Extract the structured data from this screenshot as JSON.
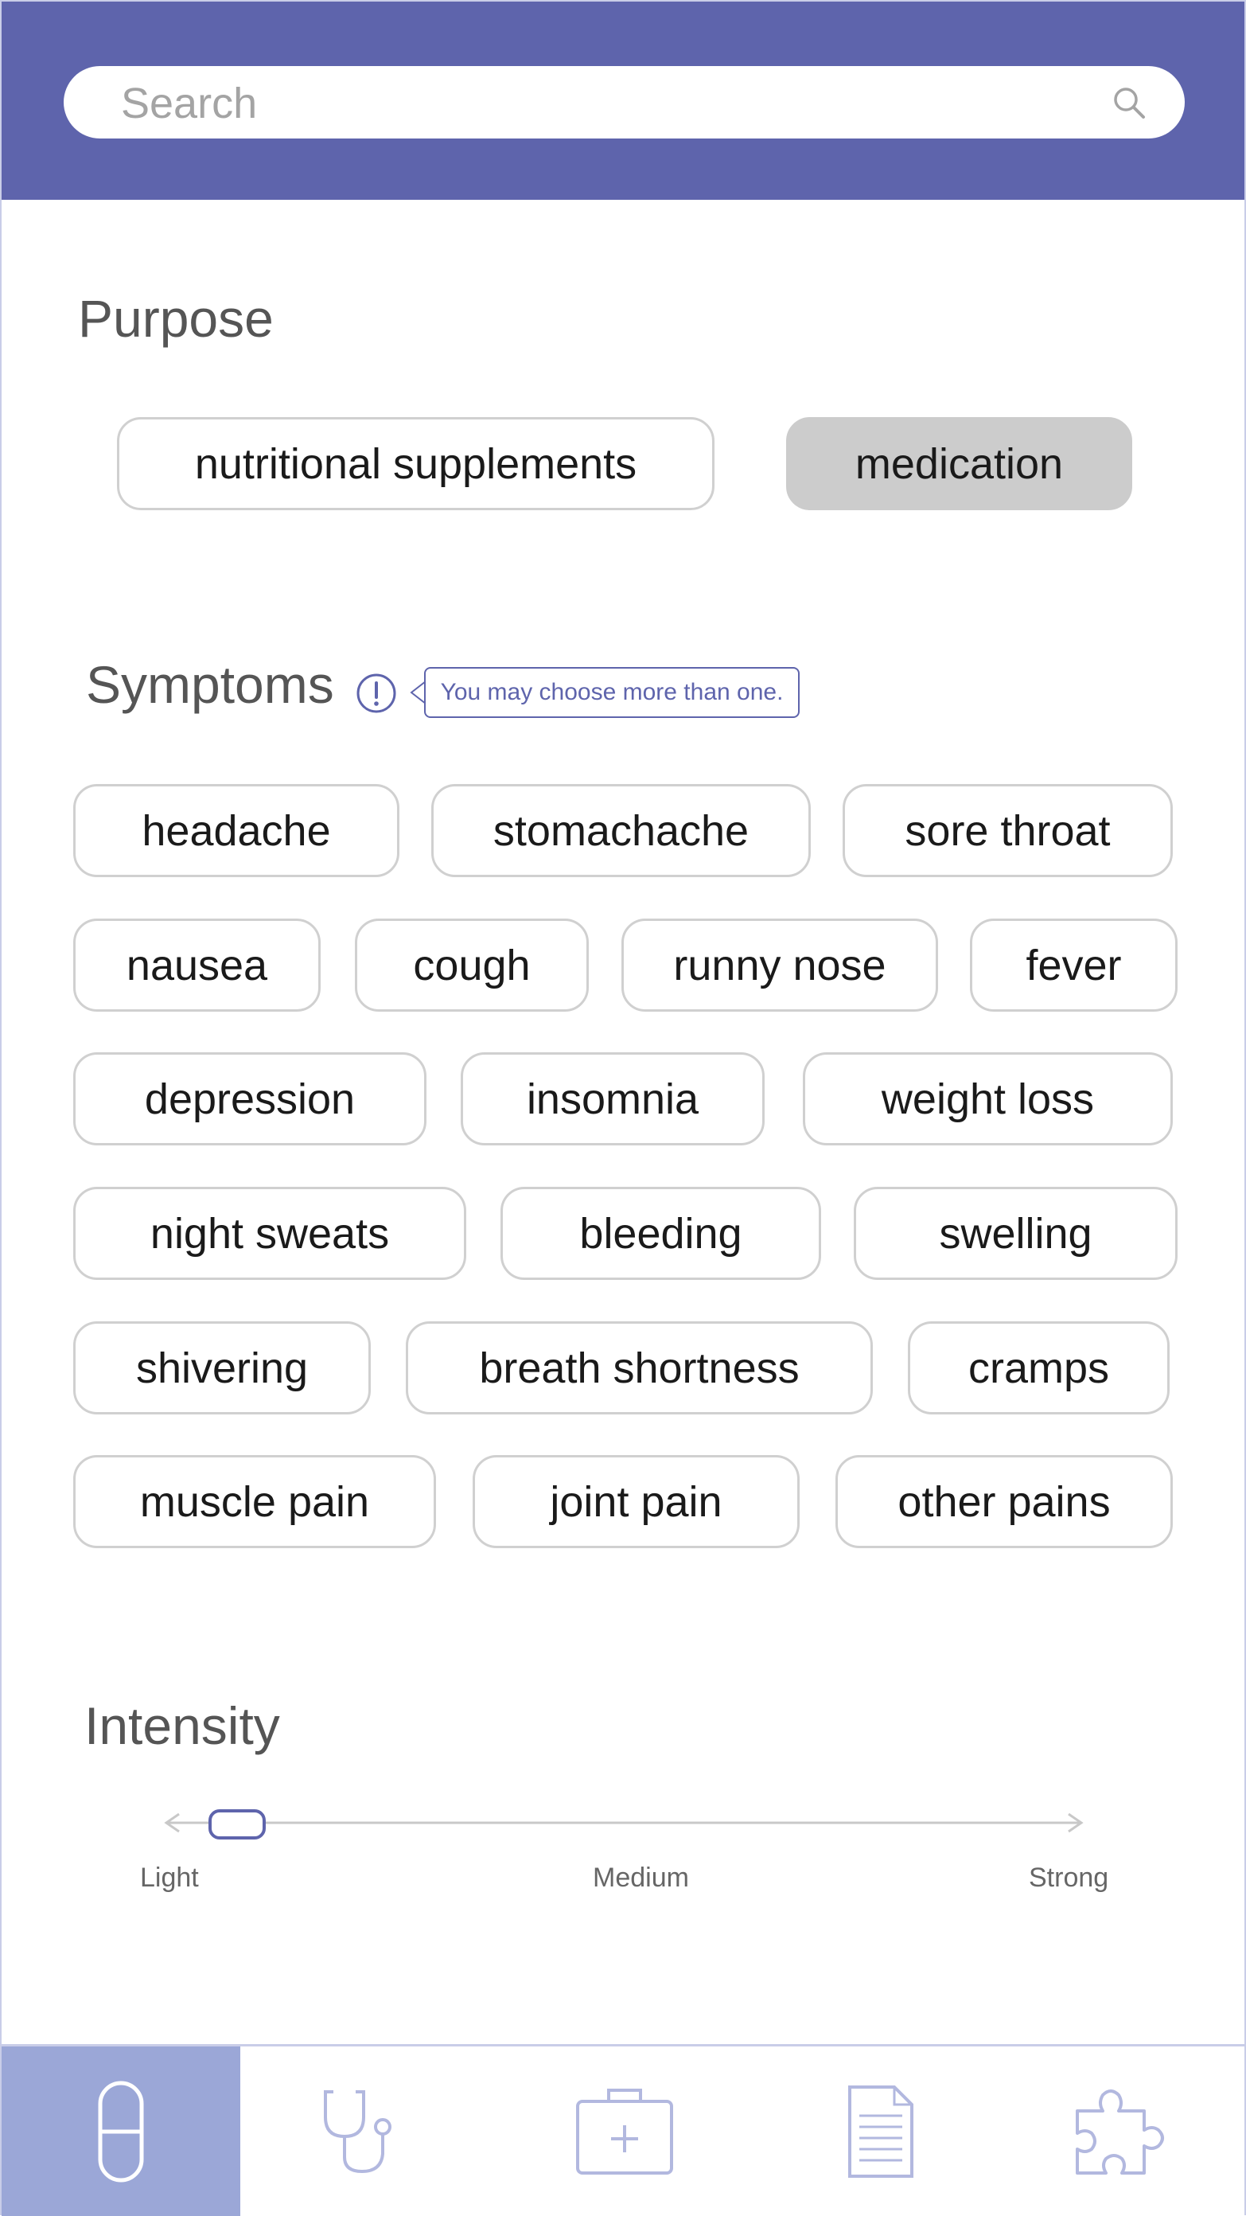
{
  "search": {
    "placeholder": "Search",
    "value": ""
  },
  "purpose": {
    "title": "Purpose",
    "options": [
      {
        "label": "nutritional supplements",
        "selected": false
      },
      {
        "label": "medication",
        "selected": true
      }
    ]
  },
  "symptoms": {
    "title": "Symptoms",
    "hint": "You may choose more than one.",
    "rows": [
      [
        "headache",
        "stomachache",
        "sore throat"
      ],
      [
        "nausea",
        "cough",
        "runny nose",
        "fever"
      ],
      [
        "depression",
        "insomnia",
        "weight loss"
      ],
      [
        "night sweats",
        "bleeding",
        "swelling"
      ],
      [
        "shivering",
        "breath shortness",
        "cramps"
      ],
      [
        "muscle pain",
        "joint pain",
        "other pains"
      ]
    ]
  },
  "intensity": {
    "title": "Intensity",
    "labels": [
      "Light",
      "Medium",
      "Strong"
    ],
    "value": "Light"
  },
  "bottom_nav": {
    "items": [
      "pill-icon",
      "stethoscope-icon",
      "first-aid-kit-icon",
      "document-icon",
      "puzzle-icon"
    ],
    "active_index": 0
  },
  "colors": {
    "brand": "#5e64ac",
    "nav_active": "#9ba7d7",
    "selected_pill": "#cccccc",
    "pill_border": "#d0d0d0"
  }
}
